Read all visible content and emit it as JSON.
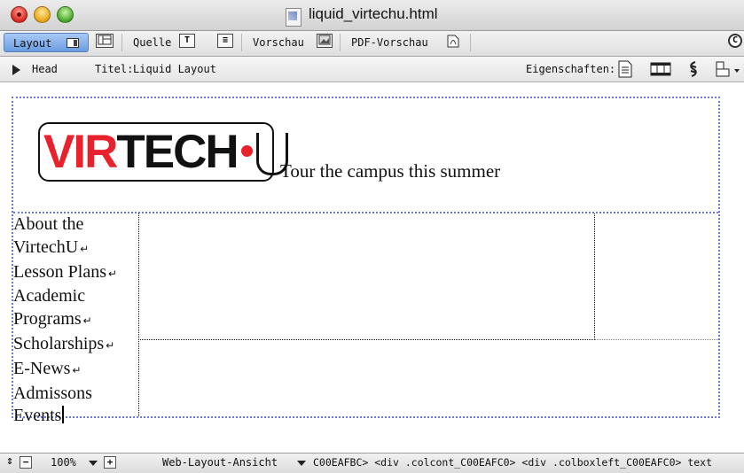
{
  "window": {
    "title": "liquid_virtechu.html"
  },
  "tabs": {
    "layout": "Layout",
    "quelle": "Quelle",
    "vorschau": "Vorschau",
    "pdf_vorschau": "PDF-Vorschau"
  },
  "headbar": {
    "head_label": "Head",
    "title_label": "Titel:",
    "title_value": "Liquid Layout",
    "properties_label": "Eigenschaften:"
  },
  "page": {
    "logo_text_red": "VIR",
    "logo_text_black": "TECH",
    "tagline": "Tour the campus this summer",
    "nav_lines": [
      {
        "text": "About the",
        "return": false
      },
      {
        "text": "VirtechU",
        "return": true
      },
      {
        "text": "Lesson Plans",
        "return": true
      },
      {
        "text": "Academic",
        "return": false
      },
      {
        "text": "Programs",
        "return": true
      },
      {
        "text": "Scholarships",
        "return": true
      },
      {
        "text": "E-News",
        "return": true
      },
      {
        "text": "Admissons",
        "return": false
      },
      {
        "text": "Events",
        "return": false
      }
    ],
    "colors": {
      "logo_red": "#e8222c",
      "frame_dotted": "#6d78d8"
    }
  },
  "statusbar": {
    "zoom": "100%",
    "view_mode": "Web-Layout-Ansicht",
    "breadcrumb": "C00EAFBC> <div .colcont_C00EAFC0> <div .colboxleft_C00EAFC0> text"
  },
  "icons": [
    "close-icon",
    "minimize-icon",
    "zoom-icon",
    "document-icon",
    "layout-icon",
    "frame-icon",
    "text-icon",
    "align-icon",
    "preview-icon",
    "pdf-icon",
    "page-props-icon",
    "film-icon",
    "link-icon",
    "shapes-icon"
  ]
}
